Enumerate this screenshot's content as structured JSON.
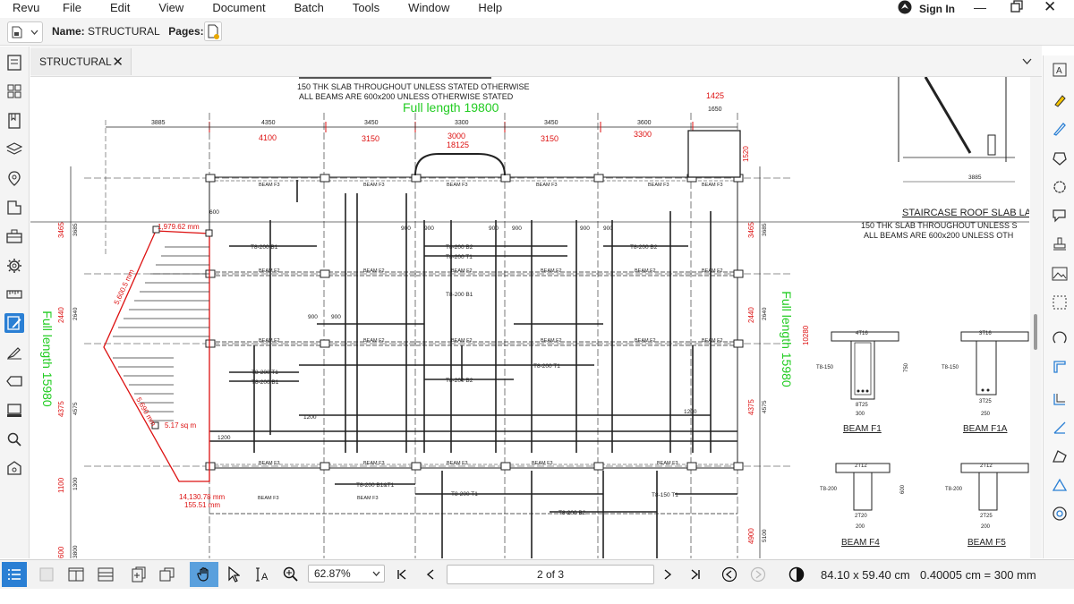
{
  "menubar": {
    "app": "Revu",
    "items": [
      "File",
      "Edit",
      "View",
      "Document",
      "Batch",
      "Tools",
      "Window",
      "Help"
    ],
    "sign_in": "Sign In"
  },
  "docbar": {
    "name_label": "Name:",
    "name_value": "STRUCTURAL",
    "pages_label": "Pages:",
    "pages_value": "3"
  },
  "tab": {
    "label": "STRUCTURAL"
  },
  "bottombar": {
    "zoom": "62.87%",
    "page": "2 of 3",
    "dimensions": "84.10 x 59.40 cm",
    "scale": "0.40005 cm = 300 mm"
  },
  "drawing": {
    "notes": {
      "line1": "150 THK SLAB THROUGHOUT UNLESS STATED OTHERWISE",
      "line2": "ALL BEAMS ARE 600x200 UNLESS OTHERWISE STATED"
    },
    "full_length_h": "Full length 19800",
    "full_length_v_left": "Full length 15980",
    "full_length_v_right": "Full length 15980",
    "dims_top_black": [
      "3885",
      "4350",
      "3450",
      "3300",
      "3450",
      "3600",
      "1650"
    ],
    "dims_top_red": [
      "4100",
      "3150",
      "3000",
      "18125",
      "3150",
      "3300",
      "1425"
    ],
    "dims_left_red": [
      "3465",
      "2440",
      "4375",
      "1100",
      "600"
    ],
    "dims_left_black": [
      "3685",
      "2640",
      "4575",
      "1300",
      "3800"
    ],
    "dims_right_red": [
      "1520",
      "3465",
      "2440",
      "4375",
      "4900"
    ],
    "dims_right_black": [
      "3685",
      "2640",
      "4575",
      "5100"
    ],
    "side_red": "10280",
    "area_labels": {
      "a1": "1,979.62 mm",
      "a2": "5,600.5 mm",
      "a3": "5.17 sq m",
      "a4": "5,690 mm",
      "a5": "14,130.78 mm",
      "a6": "155.51 mm"
    },
    "staircase_title": "STAIRCASE ROOF SLAB LA",
    "staircase_note1": "150 THK SLAB THROUGHOUT UNLESS S",
    "staircase_note2": "ALL BEAMS ARE 600x200 UNLESS OTH",
    "stair_dim": "3885",
    "beams": [
      {
        "name": "BEAM F1",
        "top": "4T16",
        "bot": "8T25",
        "link": "T8-150",
        "w": "300",
        "d": "750"
      },
      {
        "name": "BEAM F1A",
        "top": "3T16",
        "bot": "3T25",
        "link": "T8-150",
        "w": "250",
        "d": ""
      },
      {
        "name": "BEAM F4",
        "top": "2T12",
        "bot": "2T20",
        "link": "T8-200",
        "w": "200",
        "d": "600"
      },
      {
        "name": "BEAM F5",
        "top": "2T12",
        "bot": "2T25",
        "link": "T8-200",
        "w": "200",
        "d": ""
      }
    ],
    "beam_f3": "BEAM F3",
    "beam_f2": "BEAM F2",
    "rebar_b1": "T8-200  B1",
    "rebar_b2": "T8-200  B2",
    "rebar_t1": "T8-200  T1",
    "rebar_b1t1": "T8-200  B1&T1",
    "rebar_150": "T8-150  T1",
    "len_900": "900",
    "len_1200": "1200",
    "len_600": "600"
  }
}
